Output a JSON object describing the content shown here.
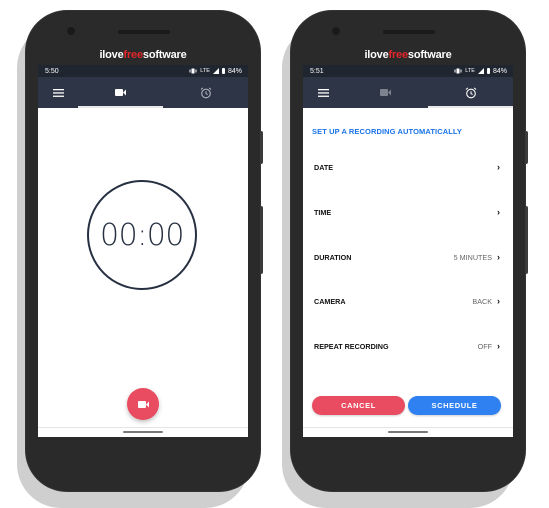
{
  "brand": {
    "part1": "ilove",
    "part2": "free",
    "part3": "software",
    "highlight_color": "#e3262a"
  },
  "phones": [
    {
      "status": {
        "time": "5:50",
        "network": "LTE",
        "battery": "84%"
      },
      "appbar": {
        "menu_icon": "hamburger-menu-icon",
        "tabs": [
          {
            "icon": "videocam-icon",
            "active": true
          },
          {
            "icon": "alarm-clock-icon",
            "active": false
          }
        ]
      },
      "timer": {
        "display": "00:00"
      },
      "fab": {
        "icon": "videocam-icon",
        "color": "#e94b60"
      }
    },
    {
      "status": {
        "time": "5:51",
        "network": "LTE",
        "battery": "84%"
      },
      "appbar": {
        "menu_icon": "hamburger-menu-icon",
        "tabs": [
          {
            "icon": "videocam-icon",
            "active": false
          },
          {
            "icon": "alarm-clock-icon",
            "active": true
          }
        ]
      },
      "schedule": {
        "title": "SET UP A RECORDING AUTOMATICALLY",
        "rows": [
          {
            "label": "DATE",
            "value": ""
          },
          {
            "label": "TIME",
            "value": ""
          },
          {
            "label": "DURATION",
            "value": "5 MINUTES"
          },
          {
            "label": "CAMERA",
            "value": "BACK"
          },
          {
            "label": "REPEAT RECORDING",
            "value": "OFF"
          }
        ],
        "chevron": "›",
        "cancel_label": "CANCEL",
        "schedule_label": "SCHEDULE"
      }
    }
  ],
  "colors": {
    "accent_blue": "#2f80f0",
    "accent_red": "#e94b60",
    "appbar": "#2d3546",
    "statusbar": "#1f2630"
  }
}
